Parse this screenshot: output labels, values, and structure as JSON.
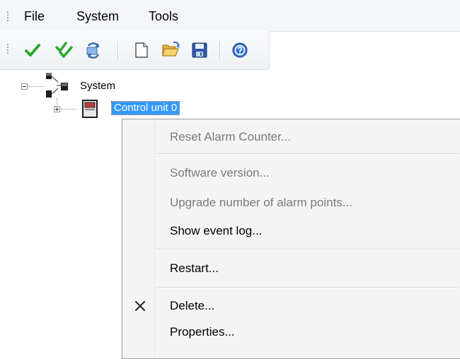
{
  "menubar": {
    "items": [
      {
        "id": "file",
        "label": "File"
      },
      {
        "id": "system",
        "label": "System"
      },
      {
        "id": "tools",
        "label": "Tools"
      }
    ]
  },
  "toolbar": {
    "buttons": [
      {
        "icon": "check-green-icon"
      },
      {
        "icon": "double-check-icon"
      },
      {
        "icon": "refresh-sync-icon"
      },
      {
        "icon": "new-document-icon"
      },
      {
        "icon": "open-folder-icon"
      },
      {
        "icon": "save-floppy-icon"
      },
      {
        "icon": "help-icon"
      }
    ]
  },
  "tree": {
    "root": {
      "label": "System",
      "expanded": true,
      "icon": "network-nodes-icon"
    },
    "child": {
      "label": "Control unit 0",
      "expanded": false,
      "selected": true,
      "icon": "control-unit-icon"
    }
  },
  "context_menu": {
    "items": [
      {
        "label": "Reset Alarm Counter...",
        "enabled": false
      },
      {
        "label": "Software version...",
        "enabled": false
      },
      {
        "label": "Upgrade number of alarm points...",
        "enabled": false
      },
      {
        "label": "Show event log...",
        "enabled": true
      },
      {
        "label": "Restart...",
        "enabled": true
      },
      {
        "label": "Delete...",
        "enabled": true,
        "icon": "delete-x-icon"
      },
      {
        "label": "Properties...",
        "enabled": true
      }
    ]
  },
  "colors": {
    "selection": "#3399ff",
    "check_green": "#2ea82e",
    "disabled_text": "#7a7a7a"
  }
}
